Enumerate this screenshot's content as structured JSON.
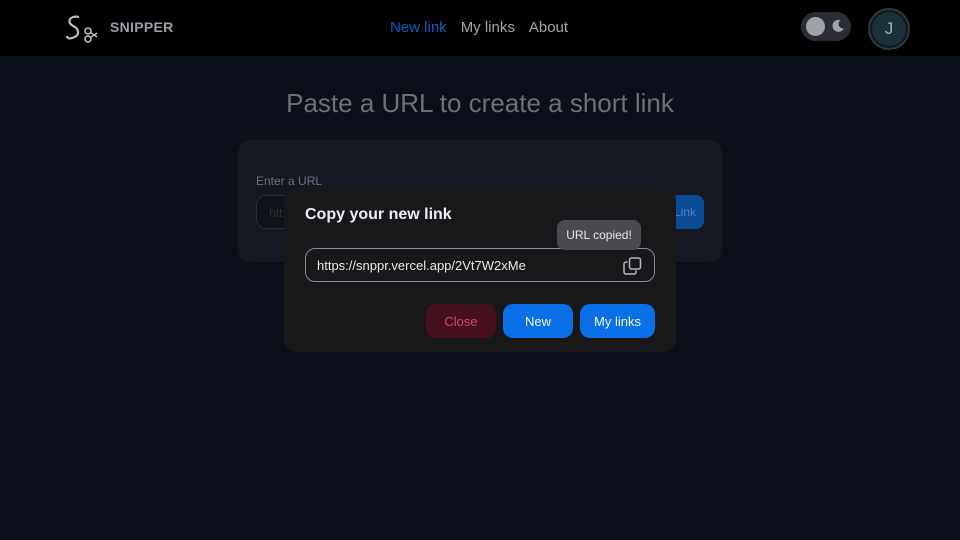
{
  "app": {
    "brand": "SNIPPER",
    "logo_icon": "scissors-s-logo-icon"
  },
  "nav": {
    "items": [
      {
        "label": "New link",
        "active": true
      },
      {
        "label": "My links",
        "active": false
      },
      {
        "label": "About",
        "active": false
      }
    ]
  },
  "header": {
    "theme_toggle": {
      "state": "dark",
      "icon": "moon-icon"
    },
    "avatar_initial": "J"
  },
  "main": {
    "headline": "Paste a URL to create a short link",
    "form": {
      "label": "Enter a URL",
      "placeholder": "htt",
      "button_label": "Link"
    }
  },
  "modal": {
    "title": "Copy your new link",
    "link": "https://snppr.vercel.app/2Vt7W2xMe",
    "copy_icon": "copy-icon",
    "tooltip": "URL copied!",
    "buttons": {
      "close": "Close",
      "new": "New",
      "my_links": "My links"
    }
  },
  "colors": {
    "accent": "#0a70e8",
    "danger": "#d3466d",
    "background": "#0b0f1a"
  }
}
